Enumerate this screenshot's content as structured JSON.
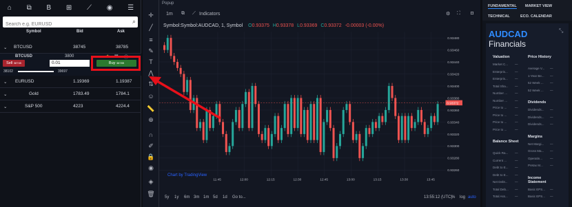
{
  "left": {
    "topicons": [
      "house-icon",
      "chart-candle-icon",
      "bitcoin-icon",
      "plus-box-icon",
      "trend-icon",
      "apple-icon",
      "settings-icon"
    ],
    "topicon_glyphs": [
      "⌂",
      "⧉",
      "B",
      "⊞",
      "⟋",
      "◉",
      "☰"
    ],
    "search_placeholder": "Search e.g. EURUSD",
    "headers": {
      "symbol": "Symbol",
      "bid": "Bid",
      "ask": "Ask"
    },
    "rows": [
      {
        "symbol": "BTCUSD",
        "bid": "38745",
        "ask": "38785",
        "expanded": true
      },
      {
        "symbol": "EURUSD",
        "bid": "1.19369",
        "ask": "1.19387"
      },
      {
        "symbol": "Gold",
        "bid": "1783.49",
        "ask": "1784.1"
      },
      {
        "symbol": "S&P 500",
        "bid": "4223",
        "ask": "4224.4"
      }
    ],
    "btc_panel": {
      "name": "BTCUSD",
      "spread": "3800",
      "sell_label": "Sell",
      "sell_price": "38745",
      "qty": "0.01",
      "buy_label": "Buy",
      "buy_price": "38785",
      "low": "38102",
      "high": "39697"
    }
  },
  "chart": {
    "popup": "Popup",
    "timeframe": "1m",
    "indicators": "Indicators",
    "symbol_line": "Symbol:Symbol:AUDCAD, 1, Symbol",
    "ohlc": {
      "o": "0.93375",
      "h": "0.93378",
      "l": "0.93369",
      "c": "0.93372",
      "chg": "-0.00003 (-0.00%)"
    },
    "last_price": "0.93372",
    "y_ticks": [
      "0.93480",
      "0.93460",
      "0.93440",
      "0.93420",
      "0.93400",
      "0.93380",
      "0.93360",
      "0.93340",
      "0.93320",
      "0.93300",
      "0.93280",
      "0.93260"
    ],
    "x_ticks": [
      "11:45",
      "12:00",
      "12:15",
      "12:30",
      "12:45",
      "13:00",
      "13:15",
      "13:30",
      "13:45"
    ],
    "credit": "Chart by TradingView",
    "ranges": [
      "5y",
      "1y",
      "6m",
      "3m",
      "1m",
      "5d",
      "1d",
      "Go to..."
    ],
    "clock": "13:55:12 (UTC)",
    "scale_opts": [
      "%",
      "log",
      "auto"
    ]
  },
  "chart_data": {
    "type": "candlestick",
    "ylim": [
      0.9325,
      0.9349
    ],
    "candles_close": [
      0.9346,
      0.9348,
      0.9345,
      0.9344,
      0.9343,
      0.9342,
      0.9339,
      0.9341,
      0.9336,
      0.9338,
      0.9333,
      0.9334,
      0.9331,
      0.9336,
      0.9333,
      0.9335,
      0.9337,
      0.9334,
      0.9332,
      0.9329,
      0.933,
      0.9334,
      0.9336,
      0.9333,
      0.9337,
      0.9339,
      0.9333,
      0.934,
      0.9337,
      0.9332,
      0.9331,
      0.9333,
      0.933,
      0.9332,
      0.9335,
      0.9331,
      0.9333,
      0.9337,
      0.9332,
      0.9338,
      0.9333,
      0.9338,
      0.9332,
      0.9336,
      0.9331,
      0.9337,
      0.9331,
      0.9338,
      0.9329,
      0.9334,
      0.9336,
      0.9333,
      0.9328,
      0.933,
      0.9332,
      0.9336,
      0.9337,
      0.9334,
      0.9331,
      0.9332,
      0.9328,
      0.933,
      0.9333,
      0.9332,
      0.9334,
      0.9333,
      0.9335,
      0.9334,
      0.9336,
      0.934,
      0.9338,
      0.9335,
      0.9331,
      0.9335,
      0.9331,
      0.9335,
      0.9333,
      0.9334,
      0.9336,
      0.9334,
      0.9332,
      0.9333,
      0.9335,
      0.9334,
      0.9337
    ]
  },
  "right": {
    "tabs": [
      "FUNDAMENTAL",
      "MARKET VIEW",
      "TECHNICAL",
      "ECO. CALENDAR"
    ],
    "title": "AUDCAD",
    "subtitle": "Financials",
    "sections_left": [
      {
        "head": "Valuation",
        "items": [
          "Market C...",
          "Enterpris...",
          "Enterpris...",
          "Total Sha...",
          "Number ...",
          "Number ...",
          "Price to ...",
          "Price to ...",
          "Price to ...",
          "Price to ..."
        ]
      },
      {
        "head": "Balance Sheet",
        "items": [
          "Quick Ra...",
          "Current ...",
          "Debt to E...",
          "Debt to E...",
          "Net Debt...",
          "Total Deb...",
          "Total Ass..."
        ]
      }
    ],
    "sections_right": [
      {
        "head": "Price History",
        "items": [
          "Average V...",
          "1-Year Be...",
          "52 Week ...",
          "52 Week ..."
        ]
      },
      {
        "head": "Dividends",
        "items": [
          "Dividends...",
          "Dividends...",
          "Dividends..."
        ]
      },
      {
        "head": "Margins",
        "items": [
          "Net Margi...",
          "Gross Ma...",
          "Operatin...",
          "Pretax M..."
        ]
      },
      {
        "head": "Income Statement",
        "items": [
          "Basic EPS...",
          "Basic EPS..."
        ]
      }
    ],
    "dash": "—"
  }
}
